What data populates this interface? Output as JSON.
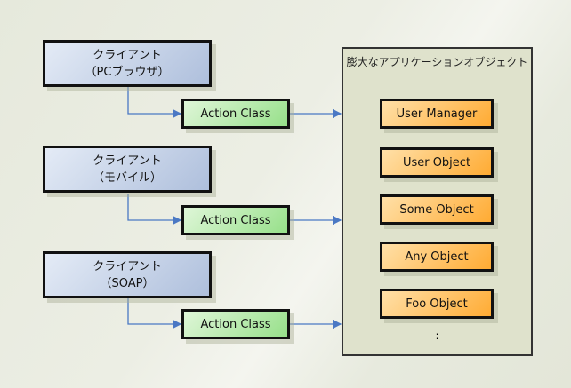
{
  "clients": [
    {
      "line1": "クライアント",
      "line2": "（PCブラウザ）"
    },
    {
      "line1": "クライアント",
      "line2": "（モバイル）"
    },
    {
      "line1": "クライアント",
      "line2": "（SOAP）"
    }
  ],
  "actions": [
    "Action Class",
    "Action Class",
    "Action Class"
  ],
  "container": {
    "title": "膨大なアプリケーションオブジェクト",
    "ellipsis": ":",
    "objects": [
      "User Manager",
      "User Object",
      "Some Object",
      "Any Object",
      "Foo Object"
    ]
  },
  "colors": {
    "client": "#aebfdc",
    "action": "#97e08a",
    "object": "#ffab33",
    "connector": "#4a78c4"
  }
}
